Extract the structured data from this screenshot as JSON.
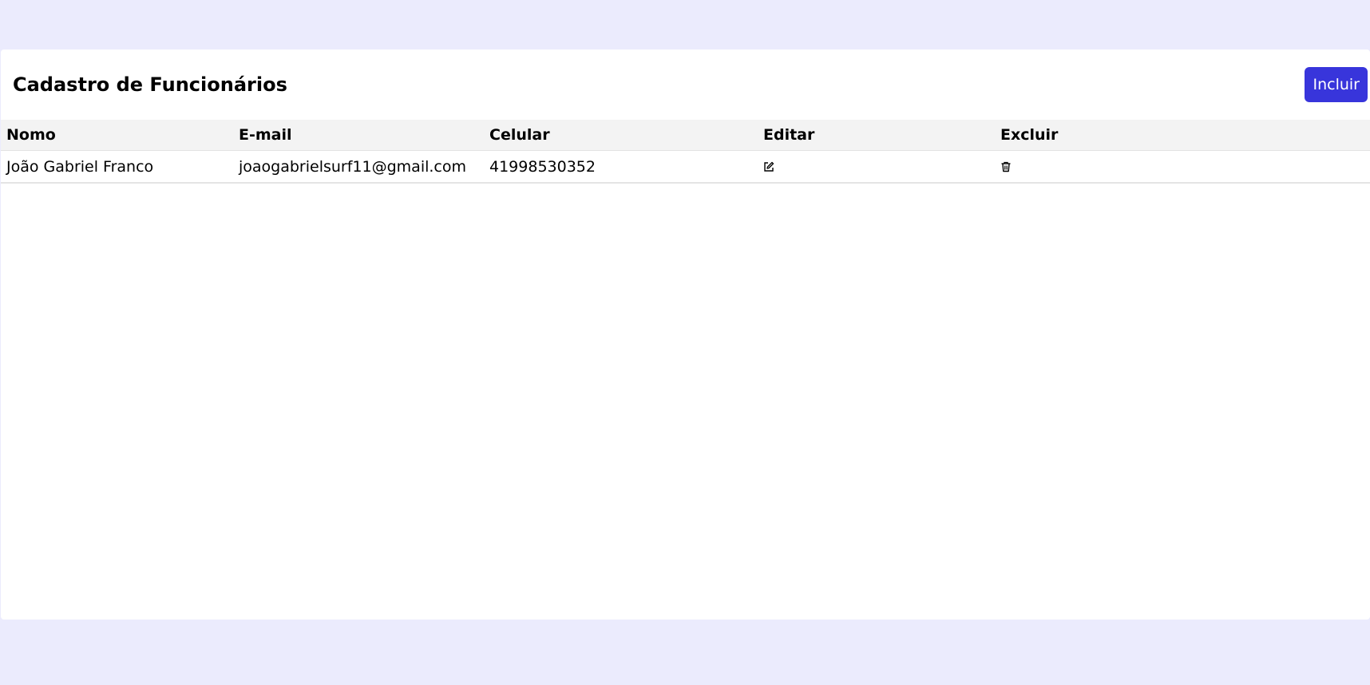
{
  "header": {
    "title": "Cadastro de Funcionários",
    "add_button_label": "Incluir"
  },
  "table": {
    "columns": [
      "Nomo",
      "E-mail",
      "Celular",
      "Editar",
      "Excluir"
    ],
    "rows": [
      {
        "name": "João Gabriel Franco",
        "email": "joaogabrielsurf11@gmail.com",
        "phone": "41998530352",
        "edit_icon": "edit-icon",
        "delete_icon": "trash-icon"
      }
    ]
  },
  "colors": {
    "page_background": "#ebebfd",
    "accent": "#3835db",
    "header_row": "#f3f3f3"
  }
}
